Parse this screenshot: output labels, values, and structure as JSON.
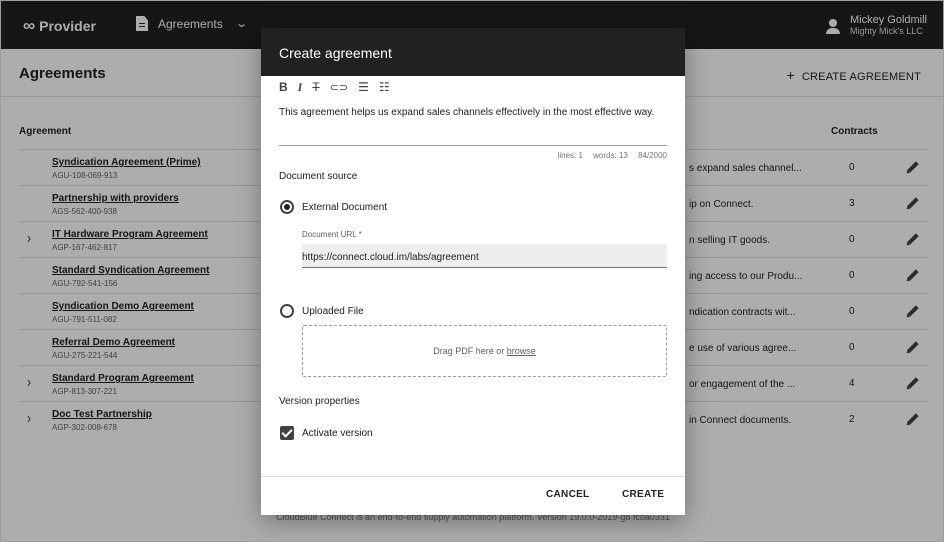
{
  "app": {
    "brand": "Provider",
    "brand_icon": "∞",
    "module": "Agreements",
    "user_name": "Mickey Goldmill",
    "user_org": "Mighty Mick's LLC"
  },
  "page": {
    "title": "Agreements",
    "create_label": "CREATE AGREEMENT"
  },
  "table": {
    "col_agreement": "Agreement",
    "col_contracts": "Contracts",
    "rows": [
      {
        "name": "Syndication Agreement (Prime)",
        "code": "AGU-108-069-913",
        "desc": "s expand sales channel...",
        "contracts": "0",
        "expandable": false
      },
      {
        "name": "Partnership with providers",
        "code": "AGS-562-400-938",
        "desc": "ip on Connect.",
        "contracts": "3",
        "expandable": false
      },
      {
        "name": "IT Hardware Program Agreement",
        "code": "AGP-167-462-817",
        "desc": "n selling IT goods.",
        "contracts": "0",
        "expandable": true
      },
      {
        "name": "Standard Syndication Agreement",
        "code": "AGU-792-541-156",
        "desc": "ing access to our Produ...",
        "contracts": "0",
        "expandable": false
      },
      {
        "name": "Syndication Demo Agreement",
        "code": "AGU-791-511-082",
        "desc": "ndication contracts wit...",
        "contracts": "0",
        "expandable": false
      },
      {
        "name": "Referral Demo Agreement",
        "code": "AGU-275-221-544",
        "desc": "e use of various agree...",
        "contracts": "0",
        "expandable": false
      },
      {
        "name": "Standard Program Agreement",
        "code": "AGP-813-307-221",
        "desc": "or engagement of the ...",
        "contracts": "4",
        "expandable": true
      },
      {
        "name": "Doc Test Partnership",
        "code": "AGP-302-008-678",
        "desc": "in Connect documents.",
        "contracts": "2",
        "expandable": true
      }
    ]
  },
  "footer": "CloudBlue Connect is an end-to-end supply automation platform. Version 19.0.0-2019-g8 fcba0331",
  "dialog": {
    "title": "Create agreement",
    "toolbar": {
      "bold": "B",
      "italic": "I",
      "strike": "T",
      "link": "🔗",
      "bullets": "☰",
      "numbers": "☰"
    },
    "editor_text": "This agreement helps us expand sales channels effectively in the most effective way.",
    "stats": {
      "lines": "lines: 1",
      "words": "words: 13",
      "chars": "84/2000"
    },
    "document_source_label": "Document source",
    "option_external": "External Document",
    "url_label": "Document URL *",
    "url_value": "https://connect.cloud.im/labs/agreement",
    "option_uploaded": "Uploaded File",
    "drop_text": "Drag PDF here or ",
    "drop_browse": "browse",
    "version_label": "Version properties",
    "activate_label": "Activate version",
    "cancel": "CANCEL",
    "create": "CREATE"
  }
}
